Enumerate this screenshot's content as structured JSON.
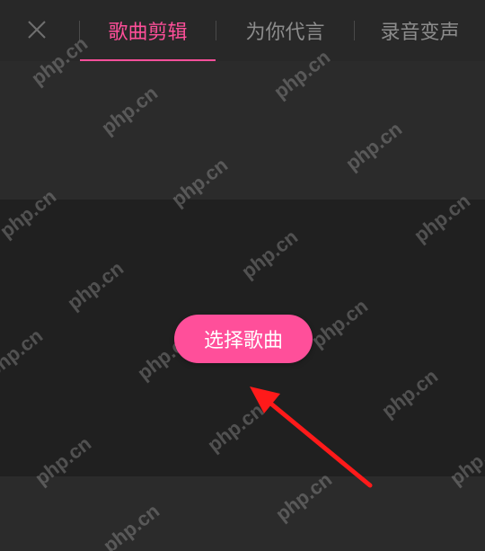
{
  "header": {
    "close_icon": "close-icon",
    "tabs": [
      {
        "label": "歌曲剪辑",
        "active": true
      },
      {
        "label": "为你代言",
        "active": false
      },
      {
        "label": "录音变声",
        "active": false
      }
    ]
  },
  "main": {
    "select_button_label": "选择歌曲"
  },
  "watermark": {
    "text": "php.cn"
  },
  "colors": {
    "accent": "#ff4f9a",
    "arrow": "#ff1a1a",
    "background": "#2a2a2a"
  }
}
